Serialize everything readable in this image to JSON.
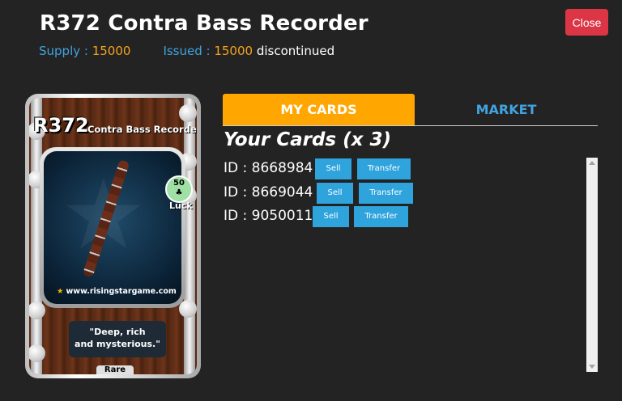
{
  "modal": {
    "title": "R372 Contra Bass Recorder",
    "supply_label": "Supply : ",
    "supply_value": "15000",
    "issued_label": "Issued : ",
    "issued_value": "15000",
    "status": "discontinued",
    "close_label": "Close"
  },
  "card": {
    "code": "R372",
    "name": "Contra Bass Recorder",
    "luck_value": "50",
    "luck_label": "Luck",
    "site": "www.risingstargame.com",
    "quote_line1": "\"Deep, rich",
    "quote_line2": "and mysterious.\"",
    "rarity": "Rare"
  },
  "tabs": [
    {
      "label": "MY CARDS",
      "active": true
    },
    {
      "label": "MARKET",
      "active": false
    }
  ],
  "your_cards": {
    "heading": "Your Cards (x 3)",
    "items": [
      {
        "id": "ID : 8668984",
        "sell": "Sell",
        "transfer": "Transfer"
      },
      {
        "id": "ID : 8669044",
        "sell": "Sell",
        "transfer": "Transfer"
      },
      {
        "id": "ID : 9050011",
        "sell": "Sell",
        "transfer": "Transfer"
      }
    ]
  },
  "colors": {
    "accent_orange": "#ffa600",
    "accent_blue": "#41a3e0",
    "close_red": "#dc3545",
    "button_blue": "#2ea3dc"
  }
}
